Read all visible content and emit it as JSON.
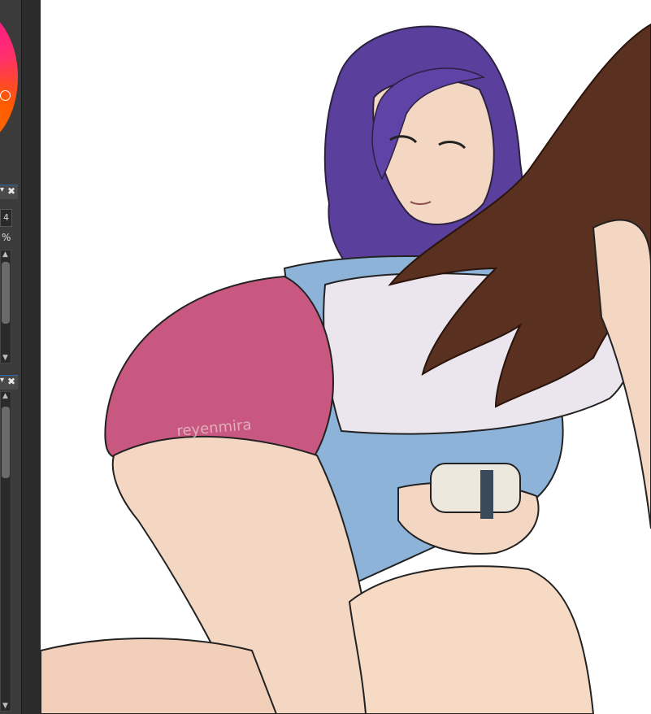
{
  "side_panel": {
    "layer_number_value": "4",
    "opacity_unit": "%",
    "color_accent": "#ff1d3a",
    "panel_close_icon": "close-icon",
    "panel_pin_icon": "pin-icon",
    "scroll_up_icon": "triangle-up-icon",
    "scroll_down_icon": "triangle-down-icon"
  },
  "canvas": {
    "watermark": "reyenmira",
    "colors": {
      "purple_hair": "#5a3f9c",
      "brown_hair": "#5a3020",
      "pink_shorts": "#c8587f",
      "blue_shirt": "#8eb3d8",
      "white_shirt": "#ebe6ee",
      "skin": "#f4d7c2"
    }
  }
}
